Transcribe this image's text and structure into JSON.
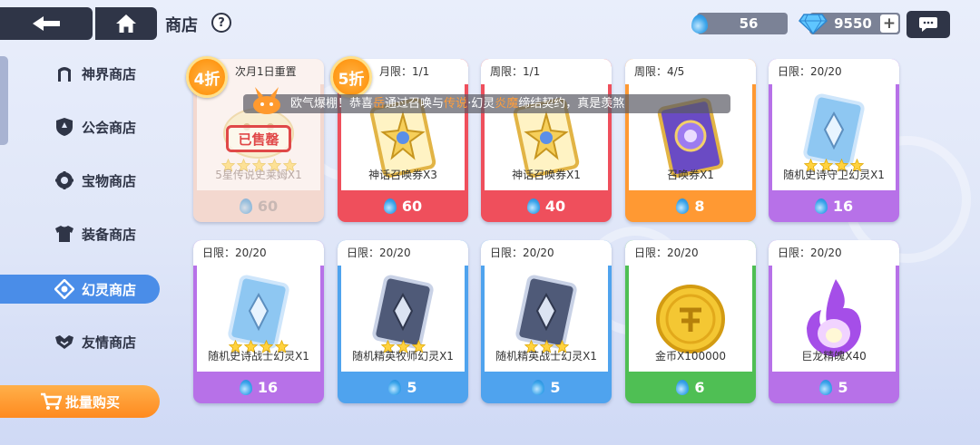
{
  "header": {
    "title": "商店",
    "help": "?",
    "currency_drops": "56",
    "currency_gems": "9550",
    "plus": "+"
  },
  "sidebar": {
    "items": [
      {
        "label": "神界商店",
        "icon": "gate-icon",
        "active": false
      },
      {
        "label": "公会商店",
        "icon": "guild-shield-icon",
        "active": false
      },
      {
        "label": "宝物商店",
        "icon": "treasure-icon",
        "active": false
      },
      {
        "label": "装备商店",
        "icon": "armor-icon",
        "active": false
      },
      {
        "label": "幻灵商店",
        "icon": "spirit-icon",
        "active": true
      },
      {
        "label": "友情商店",
        "icon": "handshake-icon",
        "active": false
      }
    ],
    "bulk_buy": "批量购买"
  },
  "marquee": {
    "prefix": "欧气爆棚！恭喜",
    "player": "岳",
    "middle": "通过召唤与",
    "quality": "传说",
    "middle2": "·幻灵",
    "spirit": "炎魔",
    "suffix": "缔结契约，真是羡煞"
  },
  "cards": [
    {
      "limit": "次月1日重置",
      "name": "5星传说史莱姆X1",
      "price": "60",
      "color": "sold",
      "discount": "4折",
      "sold": "已售罄",
      "art": "slime",
      "stars": 5
    },
    {
      "limit": "月限：1/1",
      "name": "神话召唤券X3",
      "price": "60",
      "color": "red",
      "discount": "5折",
      "art": "ticket-gold",
      "stars": 0
    },
    {
      "limit": "周限：1/1",
      "name": "神话召唤券X1",
      "price": "40",
      "color": "red",
      "art": "ticket-gold",
      "stars": 0
    },
    {
      "limit": "周限：4/5",
      "name": "召唤券X1",
      "price": "8",
      "color": "orange",
      "art": "ticket-purple",
      "stars": 0
    },
    {
      "limit": "日限：20/20",
      "name": "随机史诗守卫幻灵X1",
      "price": "16",
      "color": "purple",
      "art": "card-blue",
      "stars": 4
    },
    {
      "limit": "日限：20/20",
      "name": "随机史诗战士幻灵X1",
      "price": "16",
      "color": "purple",
      "art": "card-blue",
      "stars": 4
    },
    {
      "limit": "日限：20/20",
      "name": "随机精英牧师幻灵X1",
      "price": "5",
      "color": "blue",
      "art": "card-dark",
      "stars": 3
    },
    {
      "limit": "日限：20/20",
      "name": "随机精英战士幻灵X1",
      "price": "5",
      "color": "blue",
      "art": "card-dark",
      "stars": 3
    },
    {
      "limit": "日限：20/20",
      "name": "金币X100000",
      "price": "6",
      "color": "green",
      "art": "coin",
      "stars": 0
    },
    {
      "limit": "日限：20/20",
      "name": "巨龙精魄X40",
      "price": "5",
      "color": "purple",
      "art": "flame",
      "stars": 0
    }
  ],
  "colors": {
    "red": "#ef4f5c",
    "orange": "#ff9933",
    "purple": "#b771e8",
    "blue": "#4fa3ee",
    "green": "#4fbf54",
    "active_tab": "#4a8de8",
    "dark": "#2f3547"
  }
}
